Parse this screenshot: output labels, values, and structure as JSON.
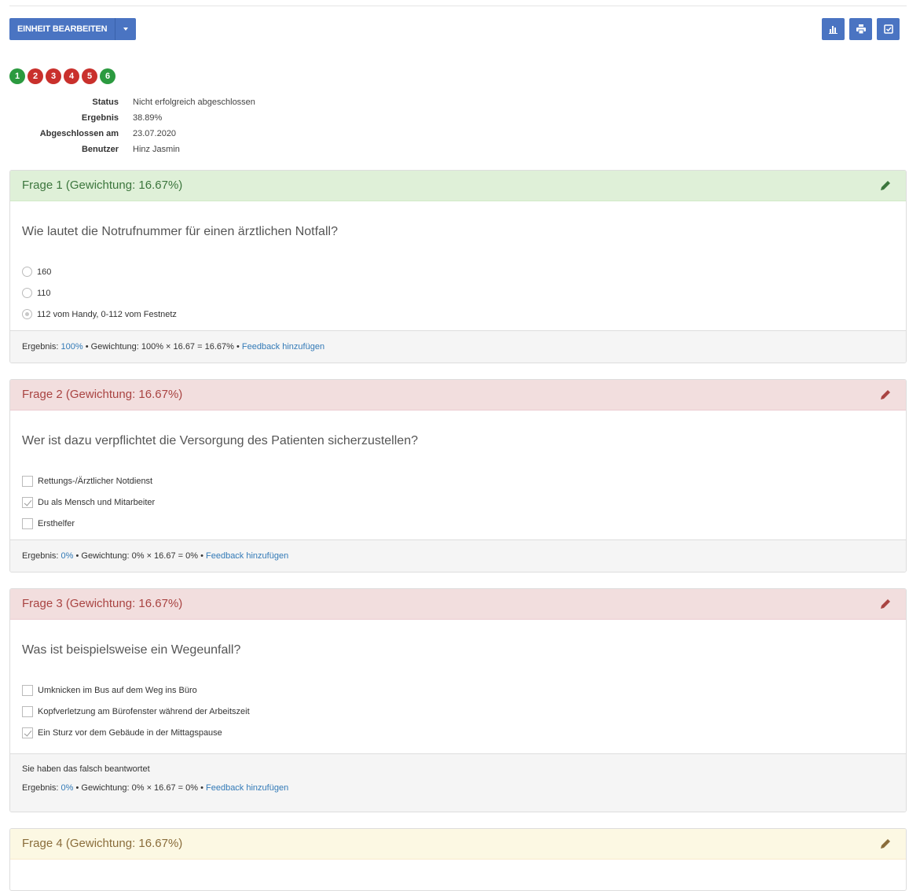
{
  "toolbar": {
    "edit_label": "EINHEIT BEARBEITEN",
    "icons": [
      "bar-chart-icon",
      "print-icon",
      "check-square-icon"
    ],
    "accent": "#4a74c2"
  },
  "badges": [
    {
      "label": "1",
      "state": "correct"
    },
    {
      "label": "2",
      "state": "wrong"
    },
    {
      "label": "3",
      "state": "wrong"
    },
    {
      "label": "4",
      "state": "wrong"
    },
    {
      "label": "5",
      "state": "wrong"
    },
    {
      "label": "6",
      "state": "correct"
    }
  ],
  "summary": {
    "status_label": "Status",
    "status_value": "Nicht erfolgreich abgeschlossen",
    "result_label": "Ergebnis",
    "result_value": "38.89%",
    "completed_label": "Abgeschlossen am",
    "completed_value": "23.07.2020",
    "user_label": "Benutzer",
    "user_value": "Hinz Jasmin"
  },
  "questions": [
    {
      "title": "Frage 1 (Gewichtung: 16.67%)",
      "text": "Wie lautet die Notrufnummer für einen ärztlichen Notfall?",
      "answers": [
        "160",
        "110",
        "112 vom Handy, 0-112 vom Festnetz"
      ],
      "footer": {
        "result_prefix": "Ergebnis:",
        "result_pct": "100%",
        "weight_text": "• Gewichtung: 100% × 16.67 = 16.67% •",
        "feedback_link": "Feedback hinzufügen"
      }
    },
    {
      "title": "Frage 2 (Gewichtung: 16.67%)",
      "text": "Wer ist dazu verpflichtet die Versorgung des Patienten sicherzustellen?",
      "answers": [
        "Rettungs-/Ärztlicher Notdienst",
        "Du als Mensch und Mitarbeiter",
        "Ersthelfer"
      ],
      "footer": {
        "result_prefix": "Ergebnis:",
        "result_pct": "0%",
        "weight_text": "• Gewichtung: 0% × 16.67 = 0% •",
        "feedback_link": "Feedback hinzufügen"
      }
    },
    {
      "title": "Frage 3 (Gewichtung: 16.67%)",
      "text": "Was ist beispielsweise ein Wegeunfall?",
      "answers": [
        "Umknicken im Bus auf dem Weg ins Büro",
        "Kopfverletzung am Bürofenster während der Arbeitszeit",
        "Ein Sturz vor dem Gebäude in der Mittagspause"
      ],
      "footer": {
        "note": "Sie haben das falsch beantwortet",
        "result_prefix": "Ergebnis:",
        "result_pct": "0%",
        "weight_text": "• Gewichtung: 0% × 16.67 = 0% •",
        "feedback_link": "Feedback hinzufügen"
      }
    },
    {
      "title": "Frage 4 (Gewichtung: 16.67%)"
    }
  ],
  "colors": {
    "correct": "#2b9a3f",
    "wrong": "#c9302c",
    "panel_green": "#dff0d8",
    "panel_red": "#f2dede",
    "panel_yellow": "#fcf8e3",
    "link": "#337ab7"
  }
}
